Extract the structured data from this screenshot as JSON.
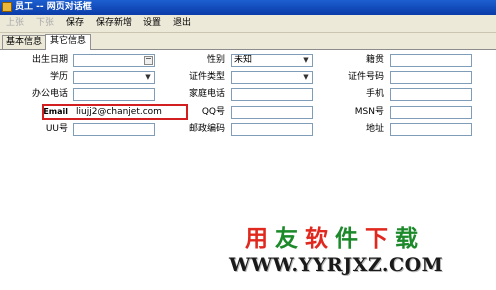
{
  "window": {
    "title": "员工 -- 网页对话框"
  },
  "toolbar": {
    "items": [
      {
        "label": "上张",
        "enabled": false
      },
      {
        "label": "下张",
        "enabled": false
      },
      {
        "label": "保存",
        "enabled": true
      },
      {
        "label": "保存新增",
        "enabled": true
      },
      {
        "label": "设置",
        "enabled": true
      },
      {
        "label": "退出",
        "enabled": true
      }
    ]
  },
  "tabs": [
    {
      "label": "基本信息",
      "active": false
    },
    {
      "label": "其它信息",
      "active": true
    }
  ],
  "form": {
    "birth_date": {
      "label": "出生日期",
      "value": ""
    },
    "gender": {
      "label": "性别",
      "value": "未知"
    },
    "native_place": {
      "label": "籍贯",
      "value": ""
    },
    "education": {
      "label": "学历",
      "value": ""
    },
    "id_type": {
      "label": "证件类型",
      "value": ""
    },
    "id_number": {
      "label": "证件号码",
      "value": ""
    },
    "office_phone": {
      "label": "办公电话",
      "value": ""
    },
    "home_phone": {
      "label": "家庭电话",
      "value": ""
    },
    "mobile": {
      "label": "手机",
      "value": ""
    },
    "email": {
      "label": "Email",
      "value": "liujj2@chanjet.com"
    },
    "qq": {
      "label": "QQ号",
      "value": ""
    },
    "msn": {
      "label": "MSN号",
      "value": ""
    },
    "uu": {
      "label": "UU号",
      "value": ""
    },
    "postcode": {
      "label": "邮政编码",
      "value": ""
    },
    "address": {
      "label": "地址",
      "value": ""
    }
  },
  "watermark": {
    "chars": [
      "用",
      "友",
      "软",
      "件",
      "下",
      "载"
    ],
    "colors": [
      "#e0281e",
      "#1c8a2a",
      "#e0281e",
      "#1c8a2a",
      "#e0281e",
      "#1c8a2a"
    ],
    "url": "WWW.YYRJXZ.COM"
  }
}
